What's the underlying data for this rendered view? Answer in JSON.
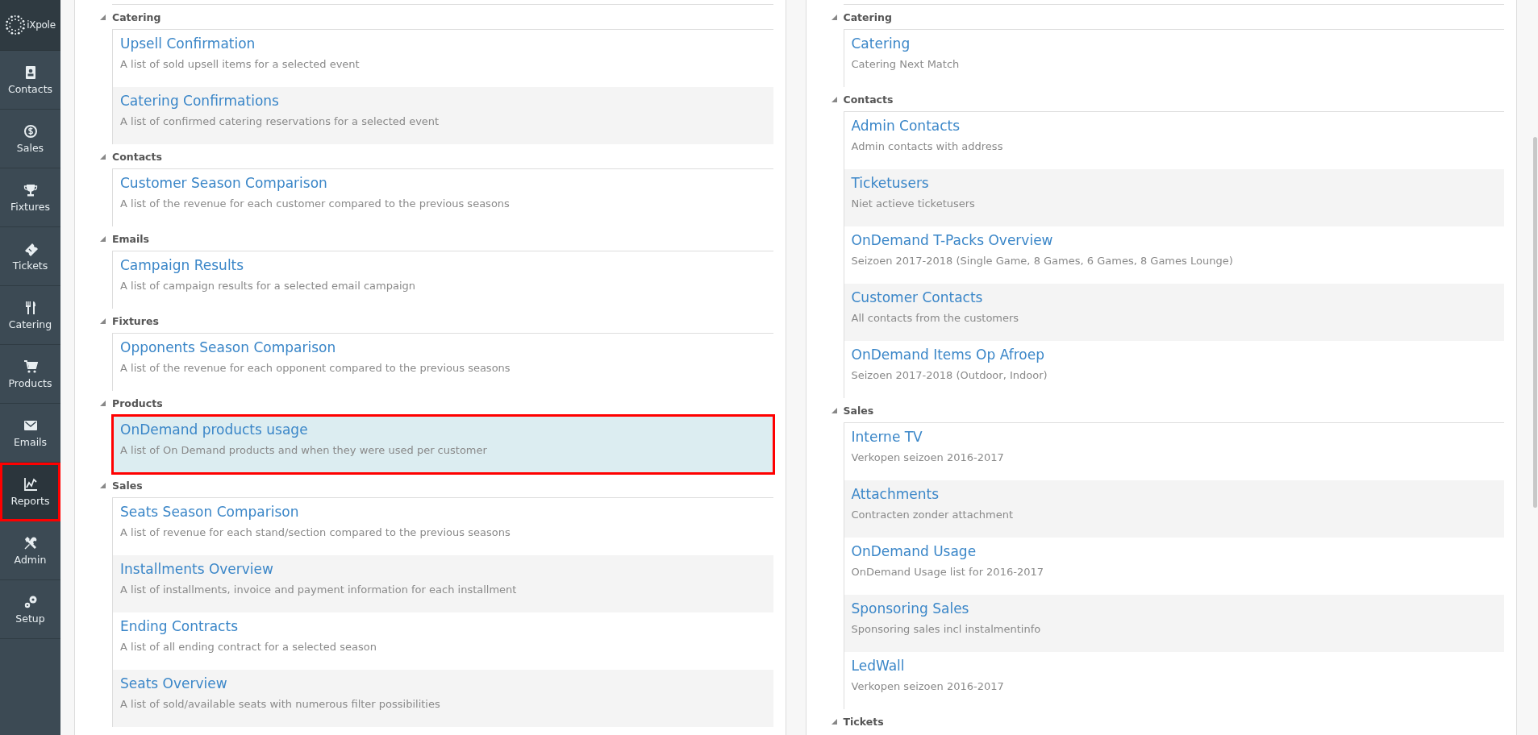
{
  "sidebar": {
    "logo": "iXpole",
    "items": [
      {
        "label": "Contacts",
        "selected": false
      },
      {
        "label": "Sales",
        "selected": false
      },
      {
        "label": "Fixtures",
        "selected": false
      },
      {
        "label": "Tickets",
        "selected": false
      },
      {
        "label": "Catering",
        "selected": false
      },
      {
        "label": "Products",
        "selected": false
      },
      {
        "label": "Emails",
        "selected": false
      },
      {
        "label": "Reports",
        "selected": true
      },
      {
        "label": "Admin",
        "selected": false
      },
      {
        "label": "Setup",
        "selected": false
      }
    ]
  },
  "columns": [
    {
      "groups": [
        {
          "label": "Catering",
          "expanded": true,
          "reports": [
            {
              "title": "Upsell Confirmation",
              "description": "A list of sold upsell items for a selected event",
              "selected": false
            },
            {
              "title": "Catering Confirmations",
              "description": "A list of confirmed catering reservations for a selected event",
              "selected": false
            }
          ]
        },
        {
          "label": "Contacts",
          "expanded": true,
          "reports": [
            {
              "title": "Customer Season Comparison",
              "description": "A list of the revenue for each customer compared to the previous seasons",
              "selected": false
            }
          ]
        },
        {
          "label": "Emails",
          "expanded": true,
          "reports": [
            {
              "title": "Campaign Results",
              "description": "A list of campaign results for a selected email campaign",
              "selected": false
            }
          ]
        },
        {
          "label": "Fixtures",
          "expanded": true,
          "reports": [
            {
              "title": "Opponents Season Comparison",
              "description": "A list of the revenue for each opponent compared to the previous seasons",
              "selected": false
            }
          ]
        },
        {
          "label": "Products",
          "expanded": true,
          "reports": [
            {
              "title": "OnDemand products usage",
              "description": "A list of On Demand products and when they were used per customer",
              "selected": true
            }
          ]
        },
        {
          "label": "Sales",
          "expanded": true,
          "reports": [
            {
              "title": "Seats Season Comparison",
              "description": "A list of revenue for each stand/section compared to the previous seasons",
              "selected": false
            },
            {
              "title": "Installments Overview",
              "description": "A list of installments, invoice and payment information for each installment",
              "selected": false
            },
            {
              "title": "Ending Contracts",
              "description": "A list of all ending contract for a selected season",
              "selected": false
            },
            {
              "title": "Seats Overview",
              "description": "A list of sold/available seats with numerous filter possibilities",
              "selected": false
            }
          ]
        }
      ]
    },
    {
      "groups": [
        {
          "label": "Catering",
          "expanded": true,
          "reports": [
            {
              "title": "Catering",
              "description": "Catering Next Match",
              "selected": false
            }
          ]
        },
        {
          "label": "Contacts",
          "expanded": true,
          "reports": [
            {
              "title": "Admin Contacts",
              "description": "Admin contacts with address",
              "selected": false
            },
            {
              "title": "Ticketusers",
              "description": "Niet actieve ticketusers",
              "selected": false
            },
            {
              "title": "OnDemand T-Packs Overview",
              "description": "Seizoen 2017-2018 (Single Game, 8 Games, 6 Games, 8 Games Lounge)",
              "selected": false
            },
            {
              "title": "Customer Contacts",
              "description": "All contacts from the customers",
              "selected": false
            },
            {
              "title": "OnDemand Items Op Afroep",
              "description": "Seizoen 2017-2018 (Outdoor, Indoor)",
              "selected": false
            }
          ]
        },
        {
          "label": "Sales",
          "expanded": true,
          "reports": [
            {
              "title": "Interne TV",
              "description": "Verkopen seizoen 2016-2017",
              "selected": false
            },
            {
              "title": "Attachments",
              "description": "Contracten zonder attachment",
              "selected": false
            },
            {
              "title": "OnDemand Usage",
              "description": "OnDemand Usage list for 2016-2017",
              "selected": false
            },
            {
              "title": "Sponsoring Sales",
              "description": "Sponsoring sales incl instalmentinfo",
              "selected": false
            },
            {
              "title": "LedWall",
              "description": "Verkopen seizoen 2016-2017",
              "selected": false
            }
          ]
        },
        {
          "label": "Tickets",
          "expanded": true
        }
      ]
    }
  ]
}
